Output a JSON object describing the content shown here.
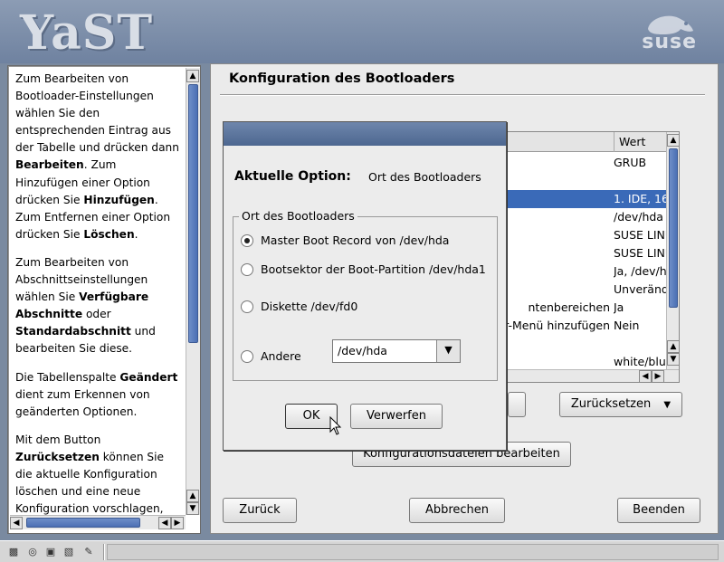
{
  "header": {
    "app_logo": "YaST",
    "brand_logo": "suse"
  },
  "help": {
    "paragraphs": [
      [
        {
          "t": "Zum Bearbeiten von Bootloader-Einstellungen wählen Sie den entsprechenden Eintrag aus der Tabelle und drücken dann "
        },
        {
          "b": "Bearbeiten"
        },
        {
          "t": ". Zum Hinzufügen einer Option drücken Sie "
        },
        {
          "b": "Hinzufügen"
        },
        {
          "t": ". Zum Entfernen einer Option drücken Sie "
        },
        {
          "b": "Löschen"
        },
        {
          "t": "."
        }
      ],
      [
        {
          "t": "Zum Bearbeiten von Abschnittseinstellungen wählen Sie "
        },
        {
          "b": "Verfügbare Abschnitte"
        },
        {
          "t": " oder "
        },
        {
          "b": "Standardabschnitt"
        },
        {
          "t": " und bearbeiten Sie diese."
        }
      ],
      [
        {
          "t": "Die Tabellenspalte "
        },
        {
          "b": "Geändert"
        },
        {
          "t": " dient zum Erkennen von geänderten Optionen."
        }
      ],
      [
        {
          "t": "Mit dem Button "
        },
        {
          "b": "Zurücksetzen"
        },
        {
          "t": " können Sie die aktuelle Konfiguration löschen und eine neue Konfiguration vorschlagen,"
        }
      ]
    ]
  },
  "main": {
    "title": "Konfiguration des Bootloaders",
    "table": {
      "headers": {
        "wert": "Wert"
      },
      "rows": [
        {
          "c": "",
          "w": "GRUB",
          "selected": false
        },
        {
          "c": "",
          "w": "",
          "selected": false
        },
        {
          "c": "",
          "w": "1. IDE, 16",
          "selected": true
        },
        {
          "c": "",
          "w": "/dev/hda",
          "selected": false
        },
        {
          "c": "",
          "w": "SUSE LINU",
          "selected": false
        },
        {
          "c": "",
          "w": "SUSE LINU",
          "selected": false
        },
        {
          "c": "",
          "w": "Ja, /dev/hc",
          "selected": false
        },
        {
          "c": "",
          "w": "Unveränd",
          "selected": false
        },
        {
          "c": "ntenbereichen",
          "w": "Ja",
          "selected": false
        },
        {
          "c": "r-Menü hinzufügen",
          "w": "Nein",
          "selected": false
        },
        {
          "c": "",
          "w": "",
          "selected": false
        },
        {
          "c": "",
          "w": "white/blue",
          "selected": false
        }
      ]
    },
    "reset_button": "Zurücksetzen",
    "config_files_button": "Konfigurationsdateien bearbeiten",
    "back_button": "Zurück",
    "cancel_button": "Abbrechen",
    "finish_button": "Beenden"
  },
  "dialog": {
    "current_option_label": "Aktuelle Option:",
    "current_option_value": "Ort des Bootloaders",
    "group_title": "Ort des Bootloaders",
    "options": [
      {
        "label": "Master Boot Record von /dev/hda",
        "selected": true
      },
      {
        "label": "Bootsektor der Boot-Partition /dev/hda1",
        "selected": false
      },
      {
        "label": "Diskette /dev/fd0",
        "selected": false
      },
      {
        "label": "Andere",
        "selected": false
      }
    ],
    "other_value": "/dev/hda",
    "ok_button": "OK",
    "discard_button": "Verwerfen"
  }
}
